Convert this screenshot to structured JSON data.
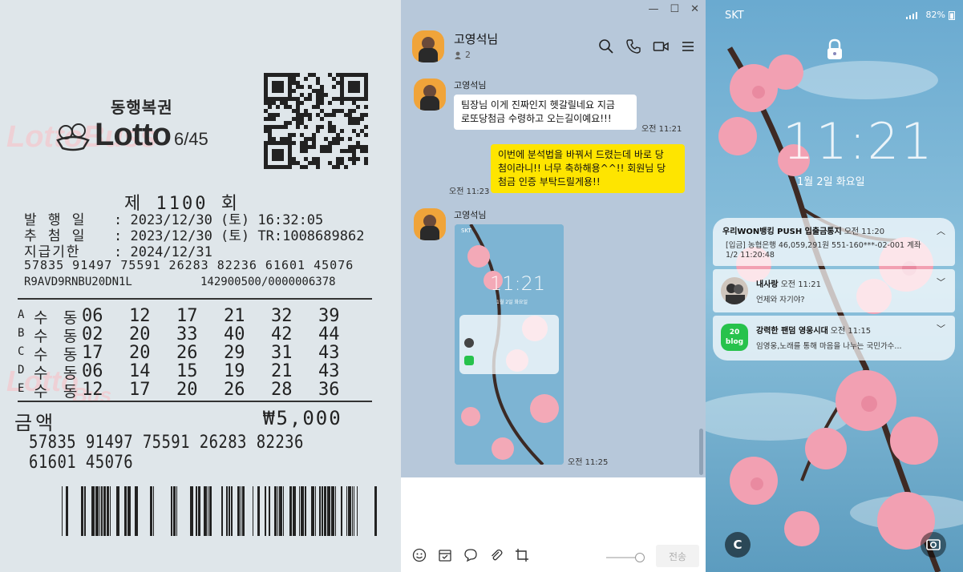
{
  "ticket": {
    "brand_sub": "동행복권",
    "brand_word": "Lotto",
    "brand_num": "6/45",
    "watermark": "LottoBuss",
    "round": "제 1100 회",
    "issue_label": "발 행 일",
    "issue_value": ": 2023/12/30 (토) 16:32:05",
    "draw_label": "추 첨 일",
    "draw_value": ": 2023/12/30 (토) TR:1008689862",
    "deadline_label": "지급기한",
    "deadline_value": ": 2024/12/31",
    "serial": "57835 91497 75591 26283 82236 61601 45076",
    "code_left": "R9AVD9RNBU20DN1L",
    "code_right": "142900500/0000006378",
    "rows": [
      {
        "letter": "A",
        "type": "수 동",
        "numbers": [
          "06",
          "12",
          "17",
          "21",
          "32",
          "39"
        ]
      },
      {
        "letter": "B",
        "type": "수 동",
        "numbers": [
          "02",
          "20",
          "33",
          "40",
          "42",
          "44"
        ]
      },
      {
        "letter": "C",
        "type": "수 동",
        "numbers": [
          "17",
          "20",
          "26",
          "29",
          "31",
          "43"
        ]
      },
      {
        "letter": "D",
        "type": "수 동",
        "numbers": [
          "06",
          "14",
          "15",
          "19",
          "21",
          "43"
        ]
      },
      {
        "letter": "E",
        "type": "수 동",
        "numbers": [
          "12",
          "17",
          "20",
          "26",
          "28",
          "36"
        ]
      }
    ],
    "amount_label": "금액",
    "amount_value": "₩5,000",
    "serial_bottom": "57835 91497 75591 26283 82236 61601 45076"
  },
  "chat": {
    "window_controls": [
      "—",
      "☐",
      "✕"
    ],
    "header_name": "고영석님",
    "member_count": "2",
    "header_icons": [
      "search-icon",
      "phone-icon",
      "video-icon",
      "menu-icon"
    ],
    "messages": [
      {
        "sender": "고영석님",
        "text_line1": "팀장님 이게 진짜인지 헷갈릴네요 지금",
        "text_line2": "로또당첨금 수령하고 오는길이예요!!!",
        "time": "오전 11:21"
      },
      {
        "mine": true,
        "text_line1": "이번에 분석법을 바꿔서 드렸는데 바로 당",
        "text_line2": "첨이라니!! 너무 축하해용^^!! 회원님 당",
        "text_line3": "첨금 인증 부탁드릴게용!!",
        "time": "오전 11:23"
      },
      {
        "sender": "고영석님",
        "attachment": "screenshot",
        "time": "오전 11:25"
      }
    ],
    "input_tools": [
      "emoji-icon",
      "calendar-icon",
      "chat-bubble-icon",
      "paperclip-icon",
      "crop-icon"
    ],
    "send_label": "전송"
  },
  "mini_shot": {
    "carrier": "SKT",
    "clock": "11:21",
    "date": "1월 2일 화요일"
  },
  "phone": {
    "carrier": "SKT",
    "battery": "82%",
    "clock": "11:21",
    "date": "1월 2일 화요일",
    "notifications": [
      {
        "app": "우리WON뱅킹 PUSH 입출금통지",
        "time": "오전 11:20",
        "line1": "[입금] 농협은행 46,059,291원 551-160***-02-001 계좌",
        "line2": "1/2 11:20:48"
      },
      {
        "app": "내사랑",
        "time": "오전 11:21",
        "line1": "언제와 자기야?"
      },
      {
        "app": "강력한 팬덤 영웅시대",
        "time": "오전 11:15",
        "line1": "임영웅,노래를 통해 마음을 나누는 국민가수..."
      }
    ],
    "blog_badge_line1": "20",
    "blog_badge_line2": "blog",
    "bottom_left_icon": "C"
  }
}
